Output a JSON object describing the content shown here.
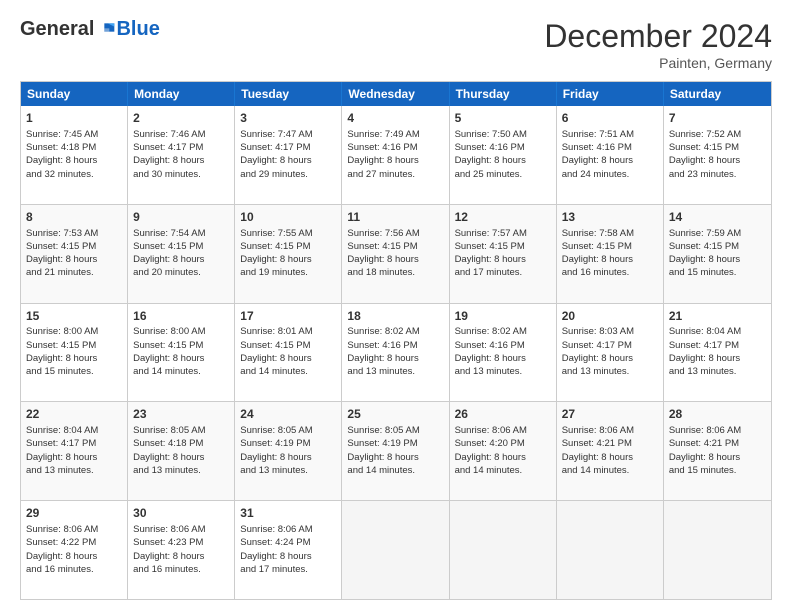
{
  "header": {
    "logo_general": "General",
    "logo_blue": "Blue",
    "month_title": "December 2024",
    "location": "Painten, Germany"
  },
  "days_of_week": [
    "Sunday",
    "Monday",
    "Tuesday",
    "Wednesday",
    "Thursday",
    "Friday",
    "Saturday"
  ],
  "weeks": [
    [
      {
        "day": "1",
        "lines": [
          "Sunrise: 7:45 AM",
          "Sunset: 4:18 PM",
          "Daylight: 8 hours",
          "and 32 minutes."
        ]
      },
      {
        "day": "2",
        "lines": [
          "Sunrise: 7:46 AM",
          "Sunset: 4:17 PM",
          "Daylight: 8 hours",
          "and 30 minutes."
        ]
      },
      {
        "day": "3",
        "lines": [
          "Sunrise: 7:47 AM",
          "Sunset: 4:17 PM",
          "Daylight: 8 hours",
          "and 29 minutes."
        ]
      },
      {
        "day": "4",
        "lines": [
          "Sunrise: 7:49 AM",
          "Sunset: 4:16 PM",
          "Daylight: 8 hours",
          "and 27 minutes."
        ]
      },
      {
        "day": "5",
        "lines": [
          "Sunrise: 7:50 AM",
          "Sunset: 4:16 PM",
          "Daylight: 8 hours",
          "and 25 minutes."
        ]
      },
      {
        "day": "6",
        "lines": [
          "Sunrise: 7:51 AM",
          "Sunset: 4:16 PM",
          "Daylight: 8 hours",
          "and 24 minutes."
        ]
      },
      {
        "day": "7",
        "lines": [
          "Sunrise: 7:52 AM",
          "Sunset: 4:15 PM",
          "Daylight: 8 hours",
          "and 23 minutes."
        ]
      }
    ],
    [
      {
        "day": "8",
        "lines": [
          "Sunrise: 7:53 AM",
          "Sunset: 4:15 PM",
          "Daylight: 8 hours",
          "and 21 minutes."
        ]
      },
      {
        "day": "9",
        "lines": [
          "Sunrise: 7:54 AM",
          "Sunset: 4:15 PM",
          "Daylight: 8 hours",
          "and 20 minutes."
        ]
      },
      {
        "day": "10",
        "lines": [
          "Sunrise: 7:55 AM",
          "Sunset: 4:15 PM",
          "Daylight: 8 hours",
          "and 19 minutes."
        ]
      },
      {
        "day": "11",
        "lines": [
          "Sunrise: 7:56 AM",
          "Sunset: 4:15 PM",
          "Daylight: 8 hours",
          "and 18 minutes."
        ]
      },
      {
        "day": "12",
        "lines": [
          "Sunrise: 7:57 AM",
          "Sunset: 4:15 PM",
          "Daylight: 8 hours",
          "and 17 minutes."
        ]
      },
      {
        "day": "13",
        "lines": [
          "Sunrise: 7:58 AM",
          "Sunset: 4:15 PM",
          "Daylight: 8 hours",
          "and 16 minutes."
        ]
      },
      {
        "day": "14",
        "lines": [
          "Sunrise: 7:59 AM",
          "Sunset: 4:15 PM",
          "Daylight: 8 hours",
          "and 15 minutes."
        ]
      }
    ],
    [
      {
        "day": "15",
        "lines": [
          "Sunrise: 8:00 AM",
          "Sunset: 4:15 PM",
          "Daylight: 8 hours",
          "and 15 minutes."
        ]
      },
      {
        "day": "16",
        "lines": [
          "Sunrise: 8:00 AM",
          "Sunset: 4:15 PM",
          "Daylight: 8 hours",
          "and 14 minutes."
        ]
      },
      {
        "day": "17",
        "lines": [
          "Sunrise: 8:01 AM",
          "Sunset: 4:15 PM",
          "Daylight: 8 hours",
          "and 14 minutes."
        ]
      },
      {
        "day": "18",
        "lines": [
          "Sunrise: 8:02 AM",
          "Sunset: 4:16 PM",
          "Daylight: 8 hours",
          "and 13 minutes."
        ]
      },
      {
        "day": "19",
        "lines": [
          "Sunrise: 8:02 AM",
          "Sunset: 4:16 PM",
          "Daylight: 8 hours",
          "and 13 minutes."
        ]
      },
      {
        "day": "20",
        "lines": [
          "Sunrise: 8:03 AM",
          "Sunset: 4:17 PM",
          "Daylight: 8 hours",
          "and 13 minutes."
        ]
      },
      {
        "day": "21",
        "lines": [
          "Sunrise: 8:04 AM",
          "Sunset: 4:17 PM",
          "Daylight: 8 hours",
          "and 13 minutes."
        ]
      }
    ],
    [
      {
        "day": "22",
        "lines": [
          "Sunrise: 8:04 AM",
          "Sunset: 4:17 PM",
          "Daylight: 8 hours",
          "and 13 minutes."
        ]
      },
      {
        "day": "23",
        "lines": [
          "Sunrise: 8:05 AM",
          "Sunset: 4:18 PM",
          "Daylight: 8 hours",
          "and 13 minutes."
        ]
      },
      {
        "day": "24",
        "lines": [
          "Sunrise: 8:05 AM",
          "Sunset: 4:19 PM",
          "Daylight: 8 hours",
          "and 13 minutes."
        ]
      },
      {
        "day": "25",
        "lines": [
          "Sunrise: 8:05 AM",
          "Sunset: 4:19 PM",
          "Daylight: 8 hours",
          "and 14 minutes."
        ]
      },
      {
        "day": "26",
        "lines": [
          "Sunrise: 8:06 AM",
          "Sunset: 4:20 PM",
          "Daylight: 8 hours",
          "and 14 minutes."
        ]
      },
      {
        "day": "27",
        "lines": [
          "Sunrise: 8:06 AM",
          "Sunset: 4:21 PM",
          "Daylight: 8 hours",
          "and 14 minutes."
        ]
      },
      {
        "day": "28",
        "lines": [
          "Sunrise: 8:06 AM",
          "Sunset: 4:21 PM",
          "Daylight: 8 hours",
          "and 15 minutes."
        ]
      }
    ],
    [
      {
        "day": "29",
        "lines": [
          "Sunrise: 8:06 AM",
          "Sunset: 4:22 PM",
          "Daylight: 8 hours",
          "and 16 minutes."
        ]
      },
      {
        "day": "30",
        "lines": [
          "Sunrise: 8:06 AM",
          "Sunset: 4:23 PM",
          "Daylight: 8 hours",
          "and 16 minutes."
        ]
      },
      {
        "day": "31",
        "lines": [
          "Sunrise: 8:06 AM",
          "Sunset: 4:24 PM",
          "Daylight: 8 hours",
          "and 17 minutes."
        ]
      },
      null,
      null,
      null,
      null
    ]
  ]
}
